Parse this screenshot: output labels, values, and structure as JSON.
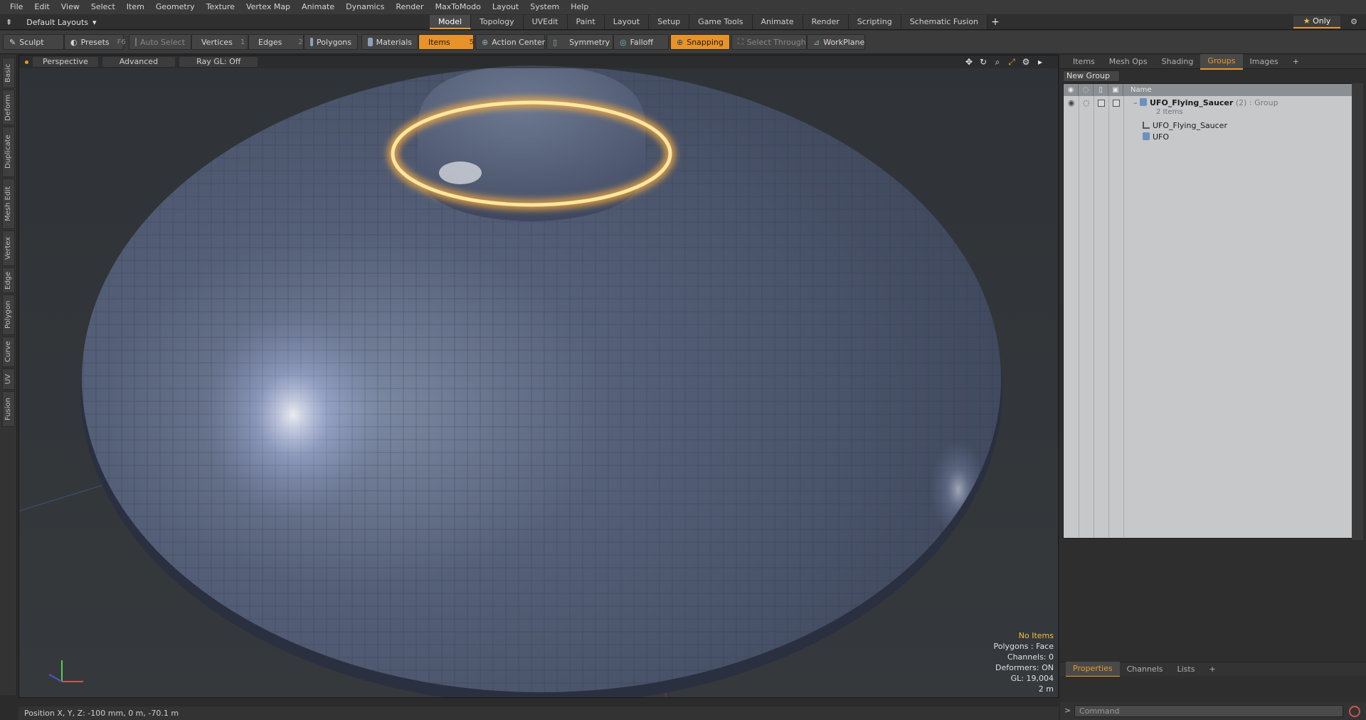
{
  "menu": [
    "File",
    "Edit",
    "View",
    "Select",
    "Item",
    "Geometry",
    "Texture",
    "Vertex Map",
    "Animate",
    "Dynamics",
    "Render",
    "MaxToModo",
    "Layout",
    "System",
    "Help"
  ],
  "layout_select": "Default Layouts",
  "layout_tabs": [
    {
      "label": "Model",
      "active": true
    },
    {
      "label": "Topology"
    },
    {
      "label": "UVEdit"
    },
    {
      "label": "Paint"
    },
    {
      "label": "Layout"
    },
    {
      "label": "Setup"
    },
    {
      "label": "Game Tools"
    },
    {
      "label": "Animate"
    },
    {
      "label": "Render"
    },
    {
      "label": "Scripting"
    },
    {
      "label": "Schematic Fusion"
    }
  ],
  "only_label": "Only",
  "toolbar": {
    "sculpt": "Sculpt",
    "presets": "Presets",
    "presets_key": "F6",
    "auto_select": "Auto Select",
    "vertices": "Vertices",
    "vertices_count": "1",
    "edges": "Edges",
    "edges_count": "2",
    "polygons": "Polygons",
    "materials": "Materials",
    "items": "Items",
    "items_count": "5",
    "action_center": "Action Center",
    "symmetry": "Symmetry",
    "falloff": "Falloff",
    "snapping": "Snapping",
    "select_through": "Select Through",
    "workplane": "WorkPlane"
  },
  "left_tabs": [
    "Basic",
    "Deform",
    "Duplicate",
    "Mesh Edit",
    "Vertex",
    "Edge",
    "Polygon",
    "Curve",
    "UV",
    "Fusion"
  ],
  "viewport": {
    "view": "Perspective",
    "advanced": "Advanced",
    "raygl": "Ray GL: Off",
    "stats": {
      "selection": "No Items",
      "polygons": "Polygons : Face",
      "channels": "Channels: 0",
      "deformers": "Deformers: ON",
      "gl": "GL: 19,004",
      "scale": "2 m"
    }
  },
  "right_tabs": [
    {
      "label": "Items"
    },
    {
      "label": "Mesh Ops"
    },
    {
      "label": "Shading"
    },
    {
      "label": "Groups",
      "active": true
    },
    {
      "label": "Images"
    }
  ],
  "new_group": "New Group",
  "list_header": "Name",
  "group": {
    "name": "UFO_Flying_Saucer",
    "count": "(2)",
    "type": ": Group",
    "sub": "2 Items",
    "children": [
      "UFO_Flying_Saucer",
      "UFO"
    ]
  },
  "props_tabs": [
    {
      "label": "Properties",
      "active": true
    },
    {
      "label": "Channels"
    },
    {
      "label": "Lists"
    }
  ],
  "command_placeholder": "Command",
  "status": "Position X, Y, Z:   -100 mm, 0 m, -70.1 m",
  "colors": {
    "accent": "#e89a2a",
    "saucer": "#4d5a70",
    "glow": "#ffd070"
  }
}
